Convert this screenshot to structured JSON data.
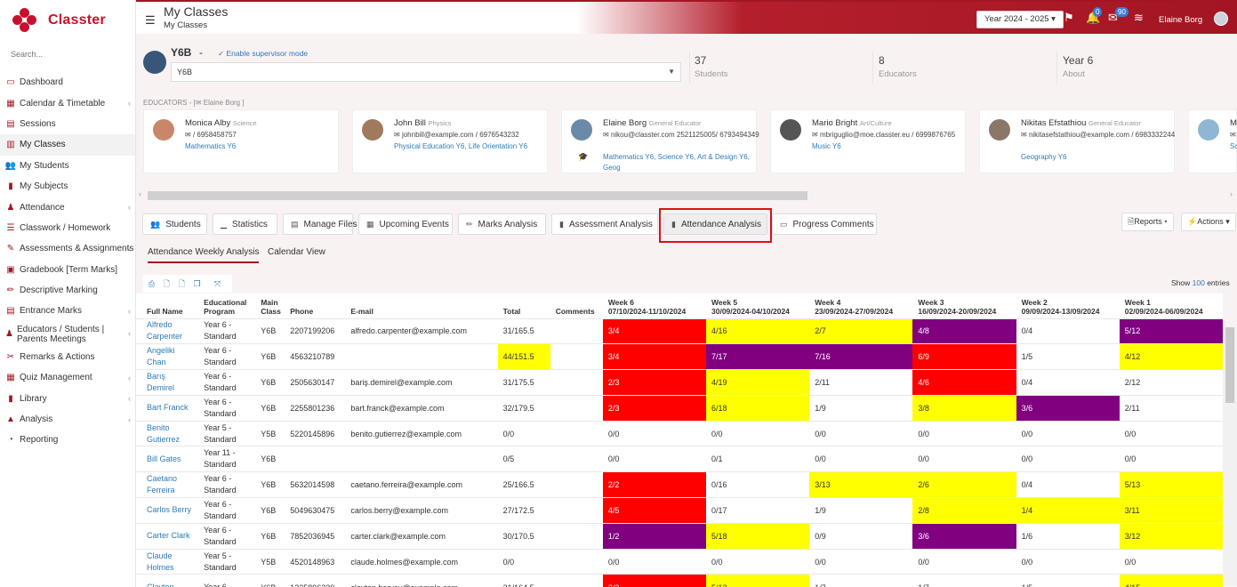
{
  "app": {
    "name": "Classter",
    "search_placeholder": "Search..."
  },
  "sidebar": {
    "items": [
      {
        "label": "Dashboard",
        "icon": "monitor-icon",
        "chev": false
      },
      {
        "label": "Calendar & Timetable",
        "icon": "calendar-icon",
        "chev": true
      },
      {
        "label": "Sessions",
        "icon": "sessions-icon",
        "chev": false
      },
      {
        "label": "My Classes",
        "icon": "classes-icon",
        "chev": false,
        "active": true
      },
      {
        "label": "My Students",
        "icon": "students-icon",
        "chev": false
      },
      {
        "label": "My Subjects",
        "icon": "book-icon",
        "chev": false
      },
      {
        "label": "Attendance",
        "icon": "attendance-icon",
        "chev": true
      },
      {
        "label": "Classwork / Homework",
        "icon": "list-icon",
        "chev": false
      },
      {
        "label": "Assessments & Assignments",
        "icon": "edit-icon",
        "chev": true
      },
      {
        "label": "Gradebook [Term Marks]",
        "icon": "gradebook-icon",
        "chev": false
      },
      {
        "label": "Descriptive Marking",
        "icon": "pencil-icon",
        "chev": false
      },
      {
        "label": "Entrance Marks",
        "icon": "document-icon",
        "chev": true
      },
      {
        "label": "Educators / Students | Parents Meetings",
        "icon": "meeting-icon",
        "chev": true,
        "two": true
      },
      {
        "label": "Remarks & Actions",
        "icon": "tools-icon",
        "chev": false
      },
      {
        "label": "Quiz Management",
        "icon": "quiz-icon",
        "chev": true
      },
      {
        "label": "Library",
        "icon": "library-icon",
        "chev": true
      },
      {
        "label": "Analysis",
        "icon": "chart-icon",
        "chev": true
      },
      {
        "label": "Reporting",
        "icon": "pie-icon",
        "chev": false
      }
    ]
  },
  "header": {
    "title": "My Classes",
    "breadcrumb": "My Classes",
    "year": "Year 2024 - 2025",
    "flag_badge": "",
    "bell_badge": "0",
    "mail_badge": "90",
    "user": "Elaine Borg"
  },
  "class": {
    "name": "Y6B",
    "dash": "-",
    "supervisor": "Enable supervisor mode",
    "selected": "Y6B"
  },
  "stats": [
    {
      "value": "37",
      "label": "Students"
    },
    {
      "value": "8",
      "label": "Educators"
    },
    {
      "value": "Year 6",
      "label": "About"
    }
  ],
  "educators_label": "EDUCATORS - ",
  "educators_owner": "Elaine Borg ]",
  "educators": [
    {
      "name": "Monica Alby",
      "role": "Science",
      "contact": "/ 6958458757",
      "subjects": "Mathematics Y6",
      "color": "#c9876a"
    },
    {
      "name": "John Bill",
      "role": "Physics",
      "contact": "johnbill@example.com / 6976543232",
      "subjects": "Physical Education Y6, Life Orientation Y6",
      "color": "#a07a5e"
    },
    {
      "name": "Elaine Borg",
      "role": "General Educator",
      "contact": "nikou@classter.com 2521125005/ 6793494349",
      "subjects": "Mathematics Y6, Science Y6, Art & Design Y6, Geog",
      "color": "#6a8aa8"
    },
    {
      "name": "Mario Bright",
      "role": "Art/Culture",
      "contact": "mbriguglio@moe.classter.eu / 6999876765",
      "subjects": "Music Y6",
      "color": "#555555"
    },
    {
      "name": "Nikitas Efstathiou",
      "role": "General Educator",
      "contact": "nikitasefstathiou@example.com / 6983332244",
      "subjects": "Geography Y6",
      "color": "#8b7768"
    },
    {
      "name": "M",
      "role": "",
      "contact": "",
      "subjects": "Sc",
      "color": "#8fb7d3"
    }
  ],
  "tabs": [
    {
      "label": "Students",
      "icon": "students-icon"
    },
    {
      "label": "Statistics",
      "icon": "stats-icon"
    },
    {
      "label": "Manage Files",
      "icon": "files-icon"
    },
    {
      "label": "Upcoming Events",
      "icon": "events-icon"
    },
    {
      "label": "Marks Analysis",
      "icon": "pencil-icon"
    },
    {
      "label": "Assessment Analysis",
      "icon": "book-icon"
    },
    {
      "label": "Attendance Analysis",
      "icon": "book-icon",
      "active": true
    },
    {
      "label": "Progress Comments",
      "icon": "comment-icon"
    }
  ],
  "reports_label": "Reports",
  "actions_label": "Actions",
  "subtabs": [
    "Attendance Weekly Analysis",
    "Calendar View"
  ],
  "show_entries": {
    "prefix": "Show",
    "count": "100",
    "suffix": "entries"
  },
  "table": {
    "headers": [
      "Full Name",
      "Educational Program",
      "Main Class",
      "Phone",
      "E-mail",
      "Total",
      "Comments"
    ],
    "weeks": [
      {
        "label": "Week 6",
        "range": "07/10/2024-11/10/2024"
      },
      {
        "label": "Week 5",
        "range": "30/09/2024-04/10/2024"
      },
      {
        "label": "Week 4",
        "range": "23/09/2024-27/09/2024"
      },
      {
        "label": "Week 3",
        "range": "16/09/2024-20/09/2024"
      },
      {
        "label": "Week 2",
        "range": "09/09/2024-13/09/2024"
      },
      {
        "label": "Week 1",
        "range": "02/09/2024-06/09/2024"
      }
    ],
    "rows": [
      {
        "name": "Alfredo Carpenter",
        "program": "Year 6 - Standard",
        "cls": "Y6B",
        "phone": "2207199206",
        "email": "alfredo.carpenter@example.com",
        "total": "31/165.5",
        "total_color": "",
        "comments": "",
        "weeks": [
          [
            "3/4",
            "red"
          ],
          [
            "4/16",
            "yel"
          ],
          [
            "2/7",
            "yel"
          ],
          [
            "4/8",
            "pur"
          ],
          [
            "0/4",
            ""
          ],
          [
            "5/12",
            "pur"
          ]
        ]
      },
      {
        "name": "Angeliki Chan",
        "program": "Year 6 - Standard",
        "cls": "Y6B",
        "phone": "4563210789",
        "email": "",
        "total": "44/151.5",
        "total_color": "yel",
        "comments": "",
        "weeks": [
          [
            "3/4",
            "red"
          ],
          [
            "7/17",
            "pur"
          ],
          [
            "7/16",
            "pur"
          ],
          [
            "6/9",
            "red"
          ],
          [
            "1/5",
            ""
          ],
          [
            "4/12",
            "yel"
          ]
        ]
      },
      {
        "name": "Barış Demirel",
        "program": "Year 6 - Standard",
        "cls": "Y6B",
        "phone": "2505630147",
        "email": "bariş.demirel@example.com",
        "total": "31/175.5",
        "total_color": "",
        "comments": "",
        "weeks": [
          [
            "2/3",
            "red"
          ],
          [
            "4/19",
            "yel"
          ],
          [
            "2/11",
            ""
          ],
          [
            "4/6",
            "red"
          ],
          [
            "0/4",
            ""
          ],
          [
            "2/12",
            ""
          ]
        ]
      },
      {
        "name": "Bart Franck",
        "program": "Year 6 - Standard",
        "cls": "Y6B",
        "phone": "2255801236",
        "email": "bart.franck@example.com",
        "total": "32/179.5",
        "total_color": "",
        "comments": "",
        "weeks": [
          [
            "2/3",
            "red"
          ],
          [
            "6/18",
            "yel"
          ],
          [
            "1/9",
            ""
          ],
          [
            "3/8",
            "yel"
          ],
          [
            "3/6",
            "pur"
          ],
          [
            "2/11",
            ""
          ]
        ]
      },
      {
        "name": "Benito Gutierrez",
        "program": "Year 5 - Standard",
        "cls": "Y5B",
        "phone": "5220145896",
        "email": "benito.gutierrez@example.com",
        "total": "0/0",
        "total_color": "",
        "comments": "",
        "weeks": [
          [
            "0/0",
            ""
          ],
          [
            "0/0",
            ""
          ],
          [
            "0/0",
            ""
          ],
          [
            "0/0",
            ""
          ],
          [
            "0/0",
            ""
          ],
          [
            "0/0",
            ""
          ]
        ]
      },
      {
        "name": "Bill Gates",
        "program": "Year 11 - Standard",
        "cls": "Y6B",
        "phone": "",
        "email": "",
        "total": "0/5",
        "total_color": "",
        "comments": "",
        "weeks": [
          [
            "0/0",
            ""
          ],
          [
            "0/1",
            ""
          ],
          [
            "0/0",
            ""
          ],
          [
            "0/0",
            ""
          ],
          [
            "0/0",
            ""
          ],
          [
            "0/0",
            ""
          ]
        ]
      },
      {
        "name": "Caetano Ferreira",
        "program": "Year 6 - Standard",
        "cls": "Y6B",
        "phone": "5632014598",
        "email": "caetano.ferreira@example.com",
        "total": "25/166.5",
        "total_color": "",
        "comments": "",
        "weeks": [
          [
            "2/2",
            "red"
          ],
          [
            "0/16",
            ""
          ],
          [
            "3/13",
            "yel"
          ],
          [
            "2/6",
            "yel"
          ],
          [
            "0/4",
            ""
          ],
          [
            "5/13",
            "yel"
          ]
        ]
      },
      {
        "name": "Carlos Berry",
        "program": "Year 6 - Standard",
        "cls": "Y6B",
        "phone": "5049630475",
        "email": "carlos.berry@example.com",
        "total": "27/172.5",
        "total_color": "",
        "comments": "",
        "weeks": [
          [
            "4/5",
            "red"
          ],
          [
            "0/17",
            ""
          ],
          [
            "1/9",
            ""
          ],
          [
            "2/8",
            "yel"
          ],
          [
            "1/4",
            "yel"
          ],
          [
            "3/11",
            "yel"
          ]
        ]
      },
      {
        "name": "Carter Clark",
        "program": "Year 6 - Standard",
        "cls": "Y6B",
        "phone": "7852036945",
        "email": "carter.clark@example.com",
        "total": "30/170.5",
        "total_color": "",
        "comments": "",
        "weeks": [
          [
            "1/2",
            "pur"
          ],
          [
            "5/18",
            "yel"
          ],
          [
            "0/9",
            ""
          ],
          [
            "3/6",
            "pur"
          ],
          [
            "1/6",
            ""
          ],
          [
            "3/12",
            "yel"
          ]
        ]
      },
      {
        "name": "Claude Holmes",
        "program": "Year 5 - Standard",
        "cls": "Y5B",
        "phone": "4520148963",
        "email": "claude.holmes@example.com",
        "total": "0/0",
        "total_color": "",
        "comments": "",
        "weeks": [
          [
            "0/0",
            ""
          ],
          [
            "0/0",
            ""
          ],
          [
            "0/0",
            ""
          ],
          [
            "0/0",
            ""
          ],
          [
            "0/0",
            ""
          ],
          [
            "0/0",
            ""
          ]
        ]
      },
      {
        "name": "Clayton",
        "program": "Year 6 -",
        "cls": "Y6B",
        "phone": "1325896330",
        "email": "clayton.harvey@example.com",
        "total": "21/164.5",
        "total_color": "",
        "comments": "",
        "weeks": [
          [
            "3/3",
            "red"
          ],
          [
            "5/13",
            "yel"
          ],
          [
            "1/7",
            ""
          ],
          [
            "1/7",
            ""
          ],
          [
            "1/5",
            ""
          ],
          [
            "4/15",
            "yel"
          ]
        ]
      }
    ]
  }
}
